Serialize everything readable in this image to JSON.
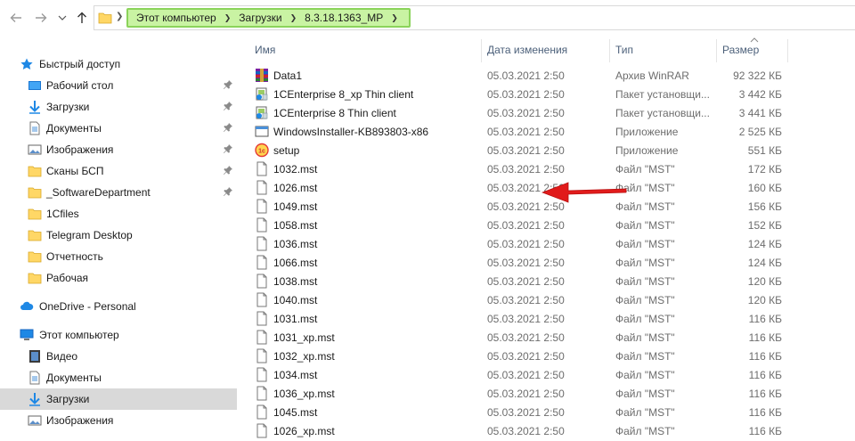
{
  "address_bar": {
    "crumbs": [
      "Этот компьютер",
      "Загрузки",
      "8.3.18.1363_MP"
    ]
  },
  "columns": {
    "name": "Имя",
    "date": "Дата изменения",
    "type": "Тип",
    "size": "Размер"
  },
  "sidebar": {
    "items": [
      {
        "label": "Быстрый доступ",
        "icon": "star-icon"
      },
      {
        "label": "Рабочий стол",
        "icon": "desktop-icon",
        "pinned": true
      },
      {
        "label": "Загрузки",
        "icon": "download-arrow-icon",
        "pinned": true
      },
      {
        "label": "Документы",
        "icon": "document-icon",
        "pinned": true
      },
      {
        "label": "Изображения",
        "icon": "pictures-icon",
        "pinned": true
      },
      {
        "label": "Сканы БСП",
        "icon": "folder-icon",
        "pinned": true
      },
      {
        "label": "_SoftwareDepartment",
        "icon": "folder-icon",
        "pinned": true
      },
      {
        "label": "1Cfiles",
        "icon": "folder-icon"
      },
      {
        "label": "Telegram Desktop",
        "icon": "folder-icon"
      },
      {
        "label": "Отчетность",
        "icon": "folder-icon"
      },
      {
        "label": "Рабочая",
        "icon": "folder-icon"
      },
      {
        "label": "OneDrive - Personal",
        "icon": "cloud-icon"
      },
      {
        "label": "Этот компьютер",
        "icon": "computer-icon"
      },
      {
        "label": "Видео",
        "icon": "video-icon"
      },
      {
        "label": "Документы",
        "icon": "document-icon"
      },
      {
        "label": "Загрузки",
        "icon": "download-arrow-icon",
        "selected": true
      },
      {
        "label": "Изображения",
        "icon": "pictures-icon"
      }
    ]
  },
  "files": [
    {
      "name": "Data1",
      "date": "05.03.2021 2:50",
      "type": "Архив WinRAR",
      "size": "92 322 КБ",
      "icon": "winrar-archive-icon"
    },
    {
      "name": "1CEnterprise 8_xp Thin client",
      "date": "05.03.2021 2:50",
      "type": "Пакет установщи...",
      "size": "3 442 КБ",
      "icon": "installer-package-icon"
    },
    {
      "name": "1CEnterprise 8 Thin client",
      "date": "05.03.2021 2:50",
      "type": "Пакет установщи...",
      "size": "3 441 КБ",
      "icon": "installer-package-icon"
    },
    {
      "name": "WindowsInstaller-KB893803-x86",
      "date": "05.03.2021 2:50",
      "type": "Приложение",
      "size": "2 525 КБ",
      "icon": "application-icon"
    },
    {
      "name": "setup",
      "date": "05.03.2021 2:50",
      "type": "Приложение",
      "size": "551 КБ",
      "icon": "1c-setup-icon"
    },
    {
      "name": "1032.mst",
      "date": "05.03.2021 2:50",
      "type": "Файл \"MST\"",
      "size": "172 КБ",
      "icon": "blank-file-icon"
    },
    {
      "name": "1026.mst",
      "date": "05.03.2021 2:50",
      "type": "Файл \"MST\"",
      "size": "160 КБ",
      "icon": "blank-file-icon"
    },
    {
      "name": "1049.mst",
      "date": "05.03.2021 2:50",
      "type": "Файл \"MST\"",
      "size": "156 КБ",
      "icon": "blank-file-icon"
    },
    {
      "name": "1058.mst",
      "date": "05.03.2021 2:50",
      "type": "Файл \"MST\"",
      "size": "152 КБ",
      "icon": "blank-file-icon"
    },
    {
      "name": "1036.mst",
      "date": "05.03.2021 2:50",
      "type": "Файл \"MST\"",
      "size": "124 КБ",
      "icon": "blank-file-icon"
    },
    {
      "name": "1066.mst",
      "date": "05.03.2021 2:50",
      "type": "Файл \"MST\"",
      "size": "124 КБ",
      "icon": "blank-file-icon"
    },
    {
      "name": "1038.mst",
      "date": "05.03.2021 2:50",
      "type": "Файл \"MST\"",
      "size": "120 КБ",
      "icon": "blank-file-icon"
    },
    {
      "name": "1040.mst",
      "date": "05.03.2021 2:50",
      "type": "Файл \"MST\"",
      "size": "120 КБ",
      "icon": "blank-file-icon"
    },
    {
      "name": "1031.mst",
      "date": "05.03.2021 2:50",
      "type": "Файл \"MST\"",
      "size": "116 КБ",
      "icon": "blank-file-icon"
    },
    {
      "name": "1031_xp.mst",
      "date": "05.03.2021 2:50",
      "type": "Файл \"MST\"",
      "size": "116 КБ",
      "icon": "blank-file-icon"
    },
    {
      "name": "1032_xp.mst",
      "date": "05.03.2021 2:50",
      "type": "Файл \"MST\"",
      "size": "116 КБ",
      "icon": "blank-file-icon"
    },
    {
      "name": "1034.mst",
      "date": "05.03.2021 2:50",
      "type": "Файл \"MST\"",
      "size": "116 КБ",
      "icon": "blank-file-icon"
    },
    {
      "name": "1036_xp.mst",
      "date": "05.03.2021 2:50",
      "type": "Файл \"MST\"",
      "size": "116 КБ",
      "icon": "blank-file-icon"
    },
    {
      "name": "1045.mst",
      "date": "05.03.2021 2:50",
      "type": "Файл \"MST\"",
      "size": "116 КБ",
      "icon": "blank-file-icon"
    },
    {
      "name": "1026_xp.mst",
      "date": "05.03.2021 2:50",
      "type": "Файл \"MST\"",
      "size": "116 КБ",
      "icon": "blank-file-icon"
    }
  ],
  "colors": {
    "crumb_highlight": "#c9f3a3",
    "crumb_border": "#8bd35b",
    "arrow": "#e11b1b",
    "selected_row": "#d9d9d9"
  }
}
